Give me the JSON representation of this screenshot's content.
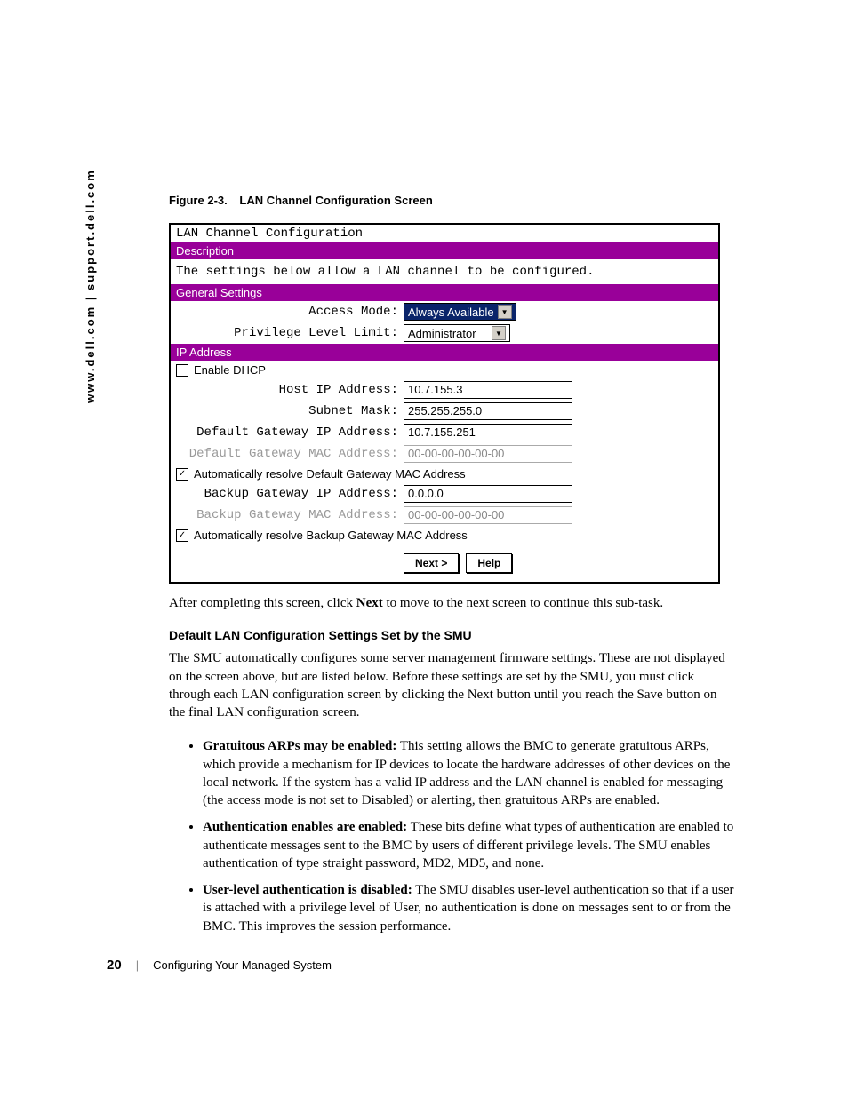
{
  "side_text": "www.dell.com | support.dell.com",
  "figure": {
    "label": "Figure 2-3.",
    "caption": "LAN Channel Configuration Screen"
  },
  "screen": {
    "title": "LAN Channel Configuration",
    "sections": {
      "description_header": "Description",
      "description_text": "The settings below allow a LAN channel to be configured.",
      "general_header": "General Settings",
      "access_mode_label": "Access Mode:",
      "access_mode_value": "Always Available",
      "priv_limit_label": "Privilege Level Limit:",
      "priv_limit_value": "Administrator",
      "ip_header": "IP Address",
      "enable_dhcp_label": "Enable DHCP",
      "host_ip_label": "Host IP Address:",
      "host_ip_value": "10.7.155.3",
      "subnet_label": "Subnet Mask:",
      "subnet_value": "255.255.255.0",
      "def_gw_ip_label": "Default Gateway IP Address:",
      "def_gw_ip_value": "10.7.155.251",
      "def_gw_mac_label": "Default Gateway MAC Address:",
      "def_gw_mac_value": "00-00-00-00-00-00",
      "auto_def_gw_label": "Automatically resolve Default Gateway MAC Address",
      "bk_gw_ip_label": "Backup Gateway IP Address:",
      "bk_gw_ip_value": "0.0.0.0",
      "bk_gw_mac_label": "Backup Gateway MAC Address:",
      "bk_gw_mac_value": "00-00-00-00-00-00",
      "auto_bk_gw_label": "Automatically resolve Backup Gateway MAC Address"
    },
    "buttons": {
      "next": "Next >",
      "help": "Help"
    }
  },
  "body": {
    "after_screen_pre": "After completing this screen, click ",
    "after_screen_bold": "Next",
    "after_screen_post": " to move to the next screen to continue this sub-task.",
    "subhead": "Default LAN Configuration Settings Set by the SMU",
    "para2": "The SMU automatically configures some server management firmware settings. These are not displayed on the screen above, but are listed below. Before these settings are set by the SMU, you must click through each LAN configuration screen by clicking the Next button until you reach the Save button on the final LAN configuration screen.",
    "bullets": [
      {
        "bold": "Gratuitous ARPs may be enabled:",
        "text": " This setting allows the BMC to generate gratuitous ARPs, which provide a mechanism for IP devices to locate the hardware addresses of other devices on the local network. If the system has a valid IP address and the LAN channel is enabled for messaging (the access mode is not set to Disabled) or alerting, then gratuitous ARPs are enabled."
      },
      {
        "bold": "Authentication enables are enabled:",
        "text": " These bits define what types of authentication are enabled to authenticate messages sent to the BMC by users of different privilege levels. The SMU enables authentication of type straight password, MD2, MD5, and none."
      },
      {
        "bold": "User-level authentication is disabled:",
        "text": " The SMU disables user-level authentication so that if a user is attached with a privilege level of User, no authentication is done on messages sent to or from the BMC. This improves the session performance."
      }
    ]
  },
  "footer": {
    "page_number": "20",
    "section": "Configuring Your Managed System"
  }
}
